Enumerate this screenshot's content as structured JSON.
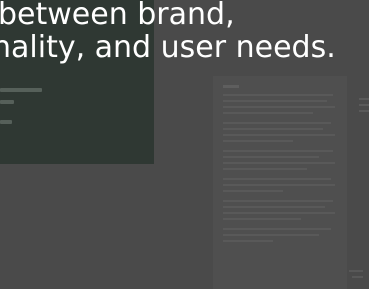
{
  "headline": {
    "line1": "between brand,",
    "line2": "nality, and user needs."
  },
  "colors": {
    "background": "#4a4a4a",
    "panel": "#2f3833",
    "text": "#ffffff"
  }
}
